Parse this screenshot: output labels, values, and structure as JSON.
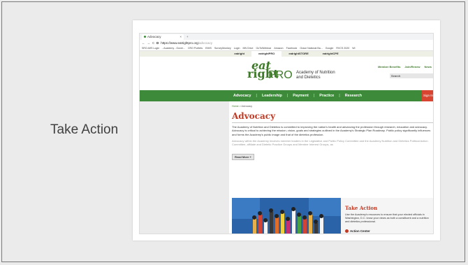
{
  "slide": {
    "title": "Take Action"
  },
  "browser": {
    "tab_label": "Advocacy",
    "tab_close": "×",
    "tab_new": "+",
    "nav_back": "←",
    "nav_forward": "→",
    "nav_reload": "C",
    "url_host": "https://www.eatrightpro.org",
    "url_path": "/advocacy",
    "bookmarks": [
      "SRO-MIS Login",
      "- Academy - Gover...",
      "CRO Portlets",
      "EMIS",
      "SurveyMonkey",
      "Login",
      "MN Drive",
      "GoToWebinar",
      "Amazon",
      "Facebook",
      "Grace National Ba...",
      "Google",
      "RVCS 2020",
      "Wi"
    ]
  },
  "site_tabs": [
    "eatright",
    "eatrightPRO",
    "eatrightSTORE",
    "eatrightCPE"
  ],
  "header": {
    "logo_eat": "eat",
    "logo_right": "right",
    "logo_pro": "PRO",
    "academy_line1": "Academy of Nutrition",
    "academy_line2": "and Dietetics",
    "util_links": [
      "Member Benefits",
      "Join/Renew",
      "News"
    ],
    "search_placeholder": "Search"
  },
  "nav": {
    "items": [
      "Advocacy",
      "Leadership",
      "Payment",
      "Practice",
      "Research"
    ],
    "signin": "Sign In"
  },
  "content": {
    "breadcrumb_home": "Home",
    "breadcrumb_sep": ">",
    "breadcrumb_current": "Advocacy",
    "heading": "Advocacy",
    "para1": "The Academy of Nutrition and Dietetics is committed to improving the nation's health and advancing the profession through research, education and advocacy. Advocacy is critical to achieving the mission, vision, goals and strategies outlined in the Academy's Strategic Plan Roadmap. Public policy significantly influences and forms the Academy's public image and that of the dietetics profession.",
    "para2": "Advocacy within the Academy involves member leaders in the Legislative and Public Policy Committee and the Academy Nutrition and Dietetics Political Action Committee, affiliate and Dietetic Practice Groups and Member Interest Groups, as",
    "read_more": "Read More +"
  },
  "take_action": {
    "title": "Take Action",
    "text": "Use the Academy's resources to ensure that your elected officials in Washington, D.C. know your views as both a constituent and a nutrition and dietetics professional.",
    "link": "Action Center"
  },
  "colors": {
    "brand_green": "#3d8b3a",
    "heading_red": "#c03a24",
    "hero_blue": "#2a63a8"
  }
}
